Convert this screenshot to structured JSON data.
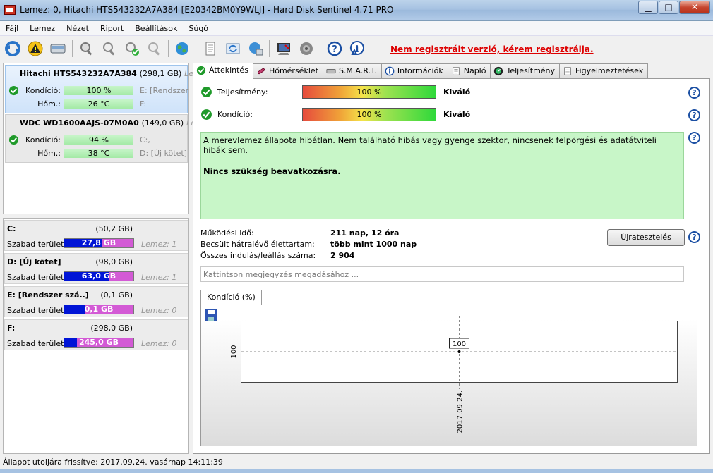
{
  "window": {
    "title": "Lemez: 0, Hitachi HTS543232A7A384 [E20342BM0Y9WLJ]  -  Hard Disk Sentinel 4.71 PRO",
    "min": "▁",
    "max": "□",
    "close": "✕"
  },
  "menu": [
    "Fájl",
    "Lemez",
    "Nézet",
    "Riport",
    "Beállítások",
    "Súgó"
  ],
  "toolbar": {
    "register_link": "Nem regisztrált verzió, kérem regisztrálja.",
    "icons": [
      "refresh-icon",
      "warning-icon",
      "disk-icon",
      "disk-test-icon",
      "disk-info-icon",
      "disk-ok-icon",
      "disk-settings-icon",
      "globe-icon",
      "report-icon",
      "sync-icon",
      "network-icon",
      "alert-icon",
      "sound-icon",
      "help-icon",
      "info-icon"
    ]
  },
  "disks": [
    {
      "name": "Hitachi HTS543232A7A384",
      "size": "(298,1 GB)",
      "more": "Leme",
      "condition_label": "Kondíció:",
      "condition": "100 %",
      "condition_pct": 100,
      "temp_label": "Hőm.:",
      "temp": "26 °C",
      "volumes_line1": "E: [Rendszer s",
      "volumes_line2": "F:"
    },
    {
      "name": "WDC WD1600AAJS-07M0A0",
      "size": "(149,0 GB)",
      "more": "Lem",
      "condition_label": "Kondíció:",
      "condition": "94 %",
      "condition_pct": 94,
      "temp_label": "Hőm.:",
      "temp": "38 °C",
      "volumes_line1": "C:,",
      "volumes_line2": "D: [Új kötet]"
    }
  ],
  "volumes": [
    {
      "name": "C:",
      "size": "(50,2 GB)",
      "free_label": "Szabad terület",
      "free": "27,8 GB",
      "free_pct": 55,
      "disk": "Lemez: 1"
    },
    {
      "name": "D: [Új kötet]",
      "size": "(98,0 GB)",
      "free_label": "Szabad terület",
      "free": "63,0 GB",
      "free_pct": 64,
      "disk": "Lemez: 1"
    },
    {
      "name": "E: [Rendszer szá..]",
      "size": "(0,1 GB)",
      "free_label": "Szabad terület",
      "free": "0,1 GB",
      "free_pct": 30,
      "disk": "Lemez: 0"
    },
    {
      "name": "F:",
      "size": "(298,0 GB)",
      "free_label": "Szabad terület",
      "free": "245,0 GB",
      "free_pct": 18,
      "disk": "Lemez: 0"
    }
  ],
  "tabs": [
    "Áttekintés",
    "Hőmérséklet",
    "S.M.A.R.T.",
    "Információk",
    "Napló",
    "Teljesítmény",
    "Figyelmeztetések"
  ],
  "overview": {
    "performance_label": "Teljesítmény:",
    "performance_value": "100 %",
    "performance_rating": "Kiváló",
    "condition_label": "Kondíció:",
    "condition_value": "100 %",
    "condition_rating": "Kiváló",
    "summary_text": "A merevlemez állapota hibátlan. Nem található hibás vagy gyenge szektor, nincsenek felpörgési és adatátviteli hibák sem.",
    "summary_action": "Nincs szükség beavatkozásra.",
    "uptime_label": "Működési idő:",
    "uptime_value": "211 nap, 12 óra",
    "lifetime_label": "Becsült hátralévő élettartam:",
    "lifetime_value": "több mint 1000 nap",
    "startstop_label": "Összes indulás/leállás száma:",
    "startstop_value": "2 904",
    "retest_button": "Újratesztelés",
    "note_placeholder": "Kattintson megjegyzés megadásához ..."
  },
  "chart_tab": "Kondíció  (%)",
  "chart_data": {
    "type": "line",
    "x": [
      "2017.09.24."
    ],
    "series": [
      {
        "values": [
          100
        ]
      }
    ],
    "data_labels": [
      "100"
    ],
    "ytick_labels": [
      "100"
    ],
    "xtick_labels": [
      "2017.09.24."
    ],
    "grid": true
  },
  "status": {
    "text": "Állapot utoljára frissítve: 2017.09.24. vasárnap 14:11:39"
  }
}
